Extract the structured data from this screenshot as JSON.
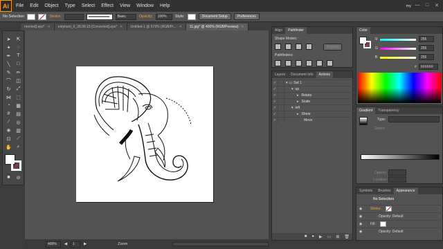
{
  "app": {
    "logo": "Ai",
    "workspace": "my"
  },
  "menu": [
    "File",
    "Edit",
    "Object",
    "Type",
    "Select",
    "Effect",
    "View",
    "Window",
    "Help"
  ],
  "control": {
    "selection": "No Selection",
    "stroke_label": "Stroke:",
    "stroke_style": "Basic",
    "opacity_label": "Opacity:",
    "opacity_value": "100%",
    "style_label": "Style:",
    "doc_setup": "Document Setup",
    "preferences": "Preferences"
  },
  "tabs": [
    {
      "label": "nverted].eps*",
      "active": false
    },
    {
      "label": "elephant_6_28.09.15 [Converted].eps*",
      "active": false
    },
    {
      "label": "Untitled-1 @ 579% (RGB/Pr...",
      "active": false
    },
    {
      "label": "11.jpg* @ 400% (RGB/Preview)",
      "active": true
    }
  ],
  "status": {
    "zoom": "400%",
    "page": "1",
    "tool": "Zoom"
  },
  "pathfinder": {
    "tabs": [
      "Align",
      "Pathfinder"
    ],
    "shape_modes": "Shape Modes:",
    "expand": "Expand",
    "pathfinders": "Pathfinders:"
  },
  "actions": {
    "tabs": [
      "Layers",
      "Document Info",
      "Actions"
    ],
    "rows": [
      {
        "label": "Set 1",
        "indent": 0
      },
      {
        "label": "up",
        "indent": 1
      },
      {
        "label": "Rotate",
        "indent": 2
      },
      {
        "label": "Scale",
        "indent": 2
      },
      {
        "label": "left",
        "indent": 1
      },
      {
        "label": "Shear",
        "indent": 2
      },
      {
        "label": "Move",
        "indent": 2
      }
    ]
  },
  "color": {
    "tab": "Color",
    "channels": [
      {
        "name": "R",
        "value": "255",
        "color": "#ff4040"
      },
      {
        "name": "G",
        "value": "255",
        "color": "#40ff40"
      },
      {
        "name": "B",
        "value": "255",
        "color": "#4040ff"
      }
    ],
    "hex_prefix": "#",
    "hex": "FFFFFF"
  },
  "gradient": {
    "tabs": [
      "Gradient",
      "Transparency"
    ],
    "type_label": "Type:",
    "stroke_label": "Stroke:",
    "opacity_label": "Opacity:",
    "location_label": "Location:"
  },
  "appearance": {
    "tabs": [
      "Symbols",
      "Brushes",
      "Appearance"
    ],
    "title": "No Selection",
    "rows": [
      {
        "label": "Stroke:",
        "orange": true
      },
      {
        "label": "Opacity: Default",
        "orange": false
      },
      {
        "label": "Fill:",
        "orange": false
      },
      {
        "label": "Opacity: Default",
        "orange": false
      }
    ]
  }
}
